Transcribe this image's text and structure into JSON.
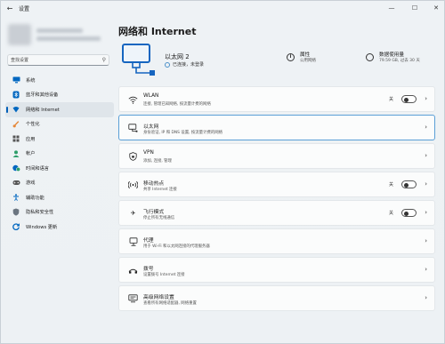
{
  "app": {
    "title": "设置"
  },
  "search": {
    "placeholder": "查找设置"
  },
  "sidebar": {
    "items": [
      {
        "label": "系统",
        "icon": "monitor-icon",
        "color": "#0067c0"
      },
      {
        "label": "蓝牙和其他设备",
        "icon": "bluetooth-icon",
        "color": "#0067c0"
      },
      {
        "label": "网络和 Internet",
        "icon": "wifi-diamond-icon",
        "color": "#0067c0",
        "active": true
      },
      {
        "label": "个性化",
        "icon": "brush-icon",
        "color": "#e5883a"
      },
      {
        "label": "应用",
        "icon": "apps-icon",
        "color": "#555"
      },
      {
        "label": "帐户",
        "icon": "person-icon",
        "color": "#2e9e6a"
      },
      {
        "label": "时间和语言",
        "icon": "globe-clock-icon",
        "color": "#0067c0"
      },
      {
        "label": "游戏",
        "icon": "gamepad-icon",
        "color": "#555"
      },
      {
        "label": "辅助功能",
        "icon": "accessibility-icon",
        "color": "#0067c0"
      },
      {
        "label": "隐私和安全性",
        "icon": "shield-icon",
        "color": "#555"
      },
      {
        "label": "Windows 更新",
        "icon": "update-icon",
        "color": "#0067c0"
      }
    ]
  },
  "main": {
    "title": "网络和 Internet",
    "ethernet": {
      "name": "以太网 2",
      "status": "已连接，未登录"
    },
    "properties": {
      "title": "属性",
      "subtitle": "公用网络"
    },
    "data_usage": {
      "title": "数据使用量",
      "subtitle": "79.59 GB, 过去 30 天"
    },
    "cards": [
      {
        "title": "WLAN",
        "subtitle": "连接, 管理已知网络, 按流量计费的网络",
        "icon": "wifi-icon",
        "toggle": "关"
      },
      {
        "title": "以太网",
        "subtitle": "身份验证, IP 和 DNS 设置, 按流量计费的网络",
        "icon": "ethernet-icon",
        "highlight": true
      },
      {
        "title": "VPN",
        "subtitle": "添加, 连接, 管理",
        "icon": "vpn-shield-icon"
      },
      {
        "title": "移动热点",
        "subtitle": "共享 Internet 连接",
        "icon": "hotspot-icon",
        "toggle": "关"
      },
      {
        "title": "飞行模式",
        "subtitle": "停止所有无线通信",
        "icon": "airplane-icon",
        "toggle": "关"
      },
      {
        "title": "代理",
        "subtitle": "用于 Wi-Fi 和以太网连接的代理服务器",
        "icon": "proxy-icon"
      },
      {
        "title": "拨号",
        "subtitle": "设置拨号 Internet 连接",
        "icon": "dialup-icon"
      },
      {
        "title": "高级网络设置",
        "subtitle": "查看所有网络适配器, 网络重置",
        "icon": "network-adapter-icon"
      }
    ]
  },
  "colors": {
    "accent": "#005fb8",
    "highlight_border": "#5a9fd6"
  }
}
